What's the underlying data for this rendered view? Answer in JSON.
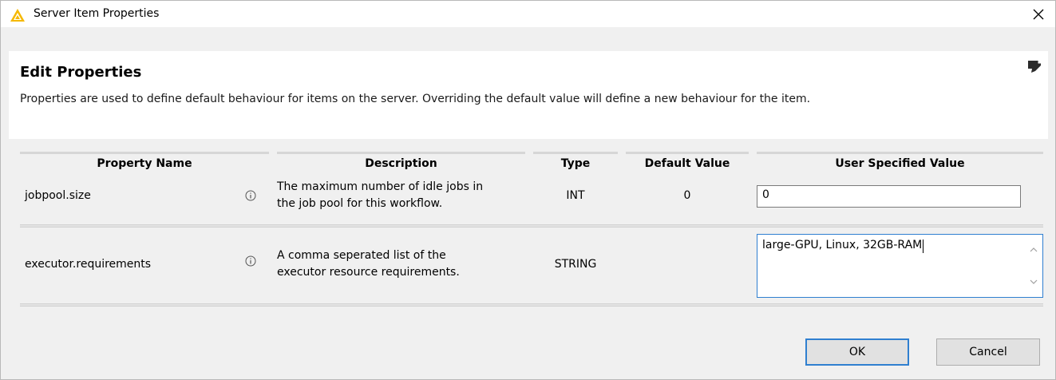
{
  "window": {
    "title": "Server Item Properties"
  },
  "header": {
    "title": "Edit Properties",
    "description": "Properties are used to define default behaviour for items on the server. Overriding the default value will define a new behaviour for the item."
  },
  "table": {
    "columns": {
      "name": "Property Name",
      "description": "Description",
      "type": "Type",
      "default": "Default Value",
      "user": "User Specified Value"
    },
    "rows": [
      {
        "name": "jobpool.size",
        "description_line1": "The maximum number of idle jobs in",
        "description_line2": "the job pool for this workflow.",
        "type": "INT",
        "default": "0",
        "user_value": "0"
      },
      {
        "name": "executor.requirements",
        "description_line1": "A comma seperated list of the",
        "description_line2": "executor resource requirements.",
        "type": "STRING",
        "default": "",
        "user_value": "large-GPU, Linux, 32GB-RAM"
      }
    ]
  },
  "buttons": {
    "ok": "OK",
    "cancel": "Cancel"
  },
  "colors": {
    "accent": "#2f7fd0",
    "icon_yellow": "#f5b800",
    "background": "#f0f0f0"
  },
  "icons": [
    "knime-app-icon",
    "close-icon",
    "edit-note-icon",
    "info-icon"
  ]
}
